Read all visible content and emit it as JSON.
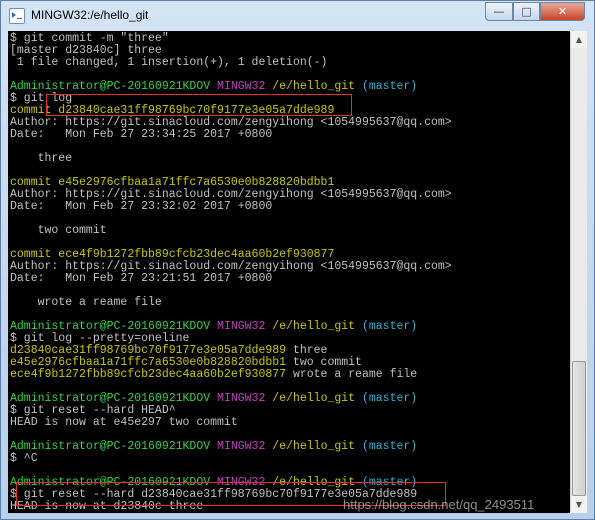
{
  "window": {
    "title": "MINGW32:/e/hello_git",
    "controls": {
      "minimize": "—",
      "maximize": "□",
      "close": "✕"
    }
  },
  "terminal": {
    "lines": [
      {
        "segs": [
          {
            "t": "$ git commit -m \"three\"",
            "c": "w"
          }
        ]
      },
      {
        "segs": [
          {
            "t": "[master d23840c] three",
            "c": "w"
          }
        ]
      },
      {
        "segs": [
          {
            "t": " 1 file changed, 1 insertion(+), 1 deletion(-)",
            "c": "w"
          }
        ]
      },
      {
        "segs": [
          {
            "t": "",
            "c": "w"
          }
        ]
      },
      {
        "segs": [
          {
            "t": "Administrator@PC-20160921KDOV",
            "c": "g"
          },
          {
            "t": " ",
            "c": "w"
          },
          {
            "t": "MINGW32",
            "c": "m"
          },
          {
            "t": " /e/hello_git",
            "c": "y"
          },
          {
            "t": " (master)",
            "c": "c"
          }
        ]
      },
      {
        "segs": [
          {
            "t": "$ git log",
            "c": "w"
          }
        ]
      },
      {
        "segs": [
          {
            "t": "commit d23840cae31ff98769bc70f9177e3e05a7dde989",
            "c": "y"
          }
        ]
      },
      {
        "segs": [
          {
            "t": "Author: https://git.sinacloud.com/zengyihong <1054995637@qq.com>",
            "c": "w"
          }
        ]
      },
      {
        "segs": [
          {
            "t": "Date:   Mon Feb 27 23:34:25 2017 +0800",
            "c": "w"
          }
        ]
      },
      {
        "segs": [
          {
            "t": "",
            "c": "w"
          }
        ]
      },
      {
        "segs": [
          {
            "t": "    three",
            "c": "w"
          }
        ]
      },
      {
        "segs": [
          {
            "t": "",
            "c": "w"
          }
        ]
      },
      {
        "segs": [
          {
            "t": "commit e45e2976cfbaa1a71ffc7a6530e0b828820bdbb1",
            "c": "y"
          }
        ]
      },
      {
        "segs": [
          {
            "t": "Author: https://git.sinacloud.com/zengyihong <1054995637@qq.com>",
            "c": "w"
          }
        ]
      },
      {
        "segs": [
          {
            "t": "Date:   Mon Feb 27 23:32:02 2017 +0800",
            "c": "w"
          }
        ]
      },
      {
        "segs": [
          {
            "t": "",
            "c": "w"
          }
        ]
      },
      {
        "segs": [
          {
            "t": "    two commit",
            "c": "w"
          }
        ]
      },
      {
        "segs": [
          {
            "t": "",
            "c": "w"
          }
        ]
      },
      {
        "segs": [
          {
            "t": "commit ece4f9b1272fbb89cfcb23dec4aa60b2ef930877",
            "c": "y"
          }
        ]
      },
      {
        "segs": [
          {
            "t": "Author: https://git.sinacloud.com/zengyihong <1054995637@qq.com>",
            "c": "w"
          }
        ]
      },
      {
        "segs": [
          {
            "t": "Date:   Mon Feb 27 23:21:51 2017 +0800",
            "c": "w"
          }
        ]
      },
      {
        "segs": [
          {
            "t": "",
            "c": "w"
          }
        ]
      },
      {
        "segs": [
          {
            "t": "    wrote a reame file",
            "c": "w"
          }
        ]
      },
      {
        "segs": [
          {
            "t": "",
            "c": "w"
          }
        ]
      },
      {
        "segs": [
          {
            "t": "Administrator@PC-20160921KDOV",
            "c": "g"
          },
          {
            "t": " ",
            "c": "w"
          },
          {
            "t": "MINGW32",
            "c": "m"
          },
          {
            "t": " /e/hello_git",
            "c": "y"
          },
          {
            "t": " (master)",
            "c": "c"
          }
        ]
      },
      {
        "segs": [
          {
            "t": "$ git log --pretty=oneline",
            "c": "w"
          }
        ]
      },
      {
        "segs": [
          {
            "t": "d23840cae31ff98769bc70f9177e3e05a7dde989",
            "c": "y"
          },
          {
            "t": " three",
            "c": "w"
          }
        ]
      },
      {
        "segs": [
          {
            "t": "e45e2976cfbaa1a71ffc7a6530e0b828820bdbb1",
            "c": "y"
          },
          {
            "t": " two commit",
            "c": "w"
          }
        ]
      },
      {
        "segs": [
          {
            "t": "ece4f9b1272fbb89cfcb23dec4aa60b2ef930877",
            "c": "y"
          },
          {
            "t": " wrote a reame file",
            "c": "w"
          }
        ]
      },
      {
        "segs": [
          {
            "t": "",
            "c": "w"
          }
        ]
      },
      {
        "segs": [
          {
            "t": "Administrator@PC-20160921KDOV",
            "c": "g"
          },
          {
            "t": " ",
            "c": "w"
          },
          {
            "t": "MINGW32",
            "c": "m"
          },
          {
            "t": " /e/hello_git",
            "c": "y"
          },
          {
            "t": " (master)",
            "c": "c"
          }
        ]
      },
      {
        "segs": [
          {
            "t": "$ git reset --hard HEAD^",
            "c": "w"
          }
        ]
      },
      {
        "segs": [
          {
            "t": "HEAD is now at e45e297 two commit",
            "c": "w"
          }
        ]
      },
      {
        "segs": [
          {
            "t": "",
            "c": "w"
          }
        ]
      },
      {
        "segs": [
          {
            "t": "Administrator@PC-20160921KDOV",
            "c": "g"
          },
          {
            "t": " ",
            "c": "w"
          },
          {
            "t": "MINGW32",
            "c": "m"
          },
          {
            "t": " /e/hello_git",
            "c": "y"
          },
          {
            "t": " (master)",
            "c": "c"
          }
        ]
      },
      {
        "segs": [
          {
            "t": "$ ^C",
            "c": "w"
          }
        ]
      },
      {
        "segs": [
          {
            "t": "",
            "c": "w"
          }
        ]
      },
      {
        "segs": [
          {
            "t": "Administrator@PC-20160921KDOV",
            "c": "g"
          },
          {
            "t": " ",
            "c": "w"
          },
          {
            "t": "MINGW32",
            "c": "m"
          },
          {
            "t": " /e/hello_git",
            "c": "y"
          },
          {
            "t": " (master)",
            "c": "c"
          }
        ]
      },
      {
        "segs": [
          {
            "t": "$ git reset --hard d23840cae31ff98769bc70f9177e3e05a7dde989",
            "c": "w"
          }
        ]
      },
      {
        "segs": [
          {
            "t": "HEAD is now at d23840c three",
            "c": "w"
          }
        ]
      }
    ]
  },
  "watermark": "https://blog.csdn.net/qq_2493511",
  "scrollbar": {
    "up": "▲",
    "down": "▼"
  },
  "colors": {
    "prompt_user": "#34d24a",
    "prompt_mingw": "#c040c0",
    "path_and_hash": "#c8c800",
    "branch": "#30b0d0",
    "highlight_box": "#e03030"
  }
}
